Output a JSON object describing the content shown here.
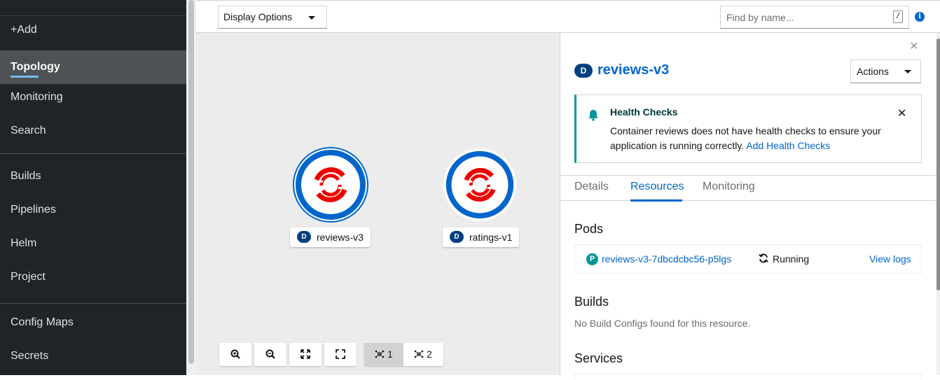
{
  "sidebar": {
    "items": [
      {
        "label": "+Add"
      },
      {
        "label": "Topology",
        "active": true
      },
      {
        "label": "Monitoring"
      },
      {
        "label": "Search"
      },
      {
        "label": "Builds"
      },
      {
        "label": "Pipelines"
      },
      {
        "label": "Helm"
      },
      {
        "label": "Project"
      },
      {
        "label": "Config Maps"
      },
      {
        "label": "Secrets"
      }
    ]
  },
  "toolbar": {
    "display_options_label": "Display Options",
    "find_placeholder": "Find by name...",
    "shortcut_key": "/",
    "info_glyph": "i"
  },
  "topology": {
    "nodes": [
      {
        "badge": "D",
        "name": "reviews-v3",
        "selected": true
      },
      {
        "badge": "D",
        "name": "ratings-v1",
        "selected": false
      }
    ],
    "controls": {
      "zoom_in": "zoom-in-icon",
      "zoom_out": "zoom-out-icon",
      "fit": "expand-icon",
      "reset": "fullscreen-icon",
      "layout1_label": "1",
      "layout2_label": "2"
    }
  },
  "panel": {
    "close_glyph": "×",
    "badge": "D",
    "title": "reviews-v3",
    "actions_label": "Actions",
    "alert": {
      "title": "Health Checks",
      "body": "Container reviews does not have health checks to ensure your application is running correctly.",
      "link": "Add Health Checks",
      "close_glyph": "✕"
    },
    "tabs": [
      {
        "label": "Details"
      },
      {
        "label": "Resources",
        "active": true
      },
      {
        "label": "Monitoring"
      }
    ],
    "pods": {
      "title": "Pods",
      "items": [
        {
          "badge": "P",
          "name": "reviews-v3-7dbcdcbc56-p5lgs",
          "status": "Running",
          "action": "View logs"
        }
      ]
    },
    "builds": {
      "title": "Builds",
      "empty": "No Build Configs found for this resource."
    },
    "services": {
      "title": "Services"
    }
  },
  "colors": {
    "sidebar_bg": "#212427",
    "accent": "#0066cc",
    "alert_border": "#009596",
    "node_ring": "#0066cc",
    "openshift_red": "#e00",
    "badge_dark": "#004080"
  }
}
